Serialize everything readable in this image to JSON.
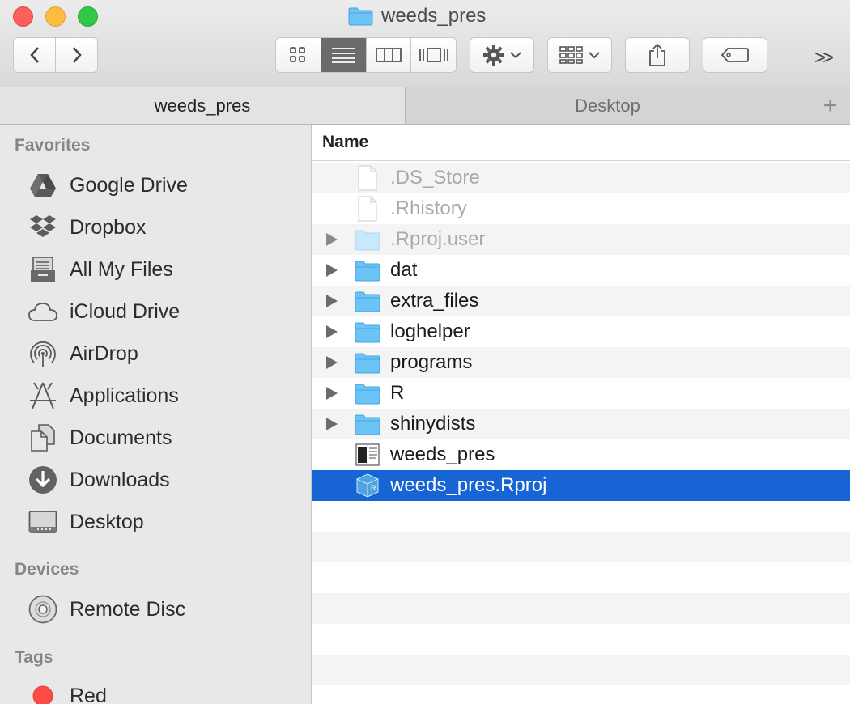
{
  "window": {
    "title": "weeds_pres"
  },
  "toolbar": {
    "back_icon": "chevron-left-icon",
    "forward_icon": "chevron-right-icon",
    "view_modes": [
      "icon",
      "list",
      "column",
      "cover-flow"
    ],
    "active_view": "list",
    "overflow": ">>"
  },
  "tabs": [
    {
      "label": "weeds_pres",
      "active": true
    },
    {
      "label": "Desktop",
      "active": false
    }
  ],
  "tab_add": "+",
  "sidebar": {
    "favorites_heading": "Favorites",
    "favorites": [
      {
        "label": "Google Drive",
        "icon": "google-drive-icon"
      },
      {
        "label": "Dropbox",
        "icon": "dropbox-icon"
      },
      {
        "label": "All My Files",
        "icon": "all-files-icon"
      },
      {
        "label": "iCloud Drive",
        "icon": "cloud-icon"
      },
      {
        "label": "AirDrop",
        "icon": "airdrop-icon"
      },
      {
        "label": "Applications",
        "icon": "applications-icon"
      },
      {
        "label": "Documents",
        "icon": "documents-icon"
      },
      {
        "label": "Downloads",
        "icon": "downloads-icon"
      },
      {
        "label": "Desktop",
        "icon": "desktop-icon"
      }
    ],
    "devices_heading": "Devices",
    "devices": [
      {
        "label": "Remote Disc",
        "icon": "disc-icon"
      }
    ],
    "tags_heading": "Tags",
    "tags": [
      {
        "label": "Red",
        "color": "#fc4b46"
      }
    ]
  },
  "file_list": {
    "column_name": "Name",
    "files": [
      {
        "name": ".DS_Store",
        "type": "file",
        "hidden": true
      },
      {
        "name": ".Rhistory",
        "type": "file",
        "hidden": true
      },
      {
        "name": ".Rproj.user",
        "type": "folder",
        "hidden": true
      },
      {
        "name": "dat",
        "type": "folder"
      },
      {
        "name": "extra_files",
        "type": "folder"
      },
      {
        "name": "loghelper",
        "type": "folder"
      },
      {
        "name": "programs",
        "type": "folder"
      },
      {
        "name": "R",
        "type": "folder"
      },
      {
        "name": "shinydists",
        "type": "folder"
      },
      {
        "name": "weeds_pres",
        "type": "document"
      },
      {
        "name": "weeds_pres.Rproj",
        "type": "rproj",
        "selected": true
      }
    ]
  },
  "colors": {
    "selection": "#1764d5",
    "folder": "#6cc4f6"
  }
}
